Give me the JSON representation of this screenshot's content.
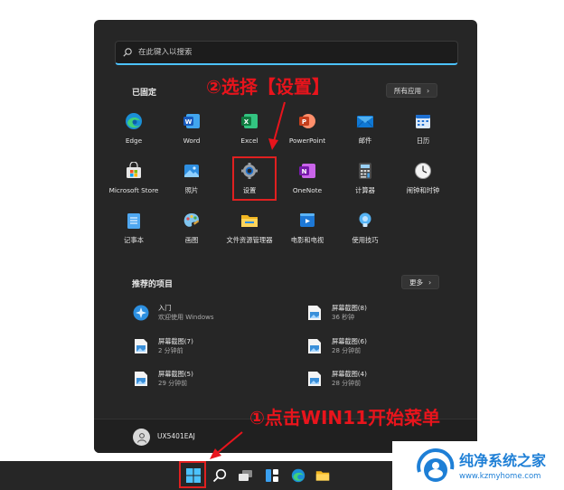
{
  "search": {
    "placeholder": "在此键入以搜索"
  },
  "pinned": {
    "title": "已固定",
    "all_apps_label": "所有应用",
    "apps": [
      {
        "label": "Edge",
        "icon": "edge-icon"
      },
      {
        "label": "Word",
        "icon": "word-icon"
      },
      {
        "label": "Excel",
        "icon": "excel-icon"
      },
      {
        "label": "PowerPoint",
        "icon": "powerpoint-icon"
      },
      {
        "label": "邮件",
        "icon": "mail-icon"
      },
      {
        "label": "日历",
        "icon": "calendar-icon"
      },
      {
        "label": "Microsoft Store",
        "icon": "store-icon"
      },
      {
        "label": "照片",
        "icon": "photos-icon"
      },
      {
        "label": "设置",
        "icon": "settings-gear-icon"
      },
      {
        "label": "OneNote",
        "icon": "onenote-icon"
      },
      {
        "label": "计算器",
        "icon": "calculator-icon"
      },
      {
        "label": "闹钟和时钟",
        "icon": "clock-icon"
      },
      {
        "label": "记事本",
        "icon": "notepad-icon"
      },
      {
        "label": "画图",
        "icon": "paint-icon"
      },
      {
        "label": "文件资源管理器",
        "icon": "folder-icon"
      },
      {
        "label": "电影和电视",
        "icon": "movies-icon"
      },
      {
        "label": "使用技巧",
        "icon": "tips-icon"
      }
    ]
  },
  "recommended": {
    "title": "推荐的项目",
    "more_label": "更多",
    "items": [
      {
        "name": "入门",
        "sub": "欢迎使用 Windows",
        "icon": "get-started-icon"
      },
      {
        "name": "屏幕截图(8)",
        "sub": "36 秒钟",
        "icon": "image-file-icon"
      },
      {
        "name": "屏幕截图(7)",
        "sub": "2 分钟前",
        "icon": "image-file-icon"
      },
      {
        "name": "屏幕截图(6)",
        "sub": "28 分钟前",
        "icon": "image-file-icon"
      },
      {
        "name": "屏幕截图(5)",
        "sub": "29 分钟前",
        "icon": "image-file-icon"
      },
      {
        "name": "屏幕截图(4)",
        "sub": "28 分钟前",
        "icon": "image-file-icon"
      }
    ]
  },
  "user": {
    "name": "UX5401EAJ"
  },
  "annotations": {
    "step1": "①点击WIN11开始菜单",
    "step2": "②选择【设置】"
  },
  "watermark": {
    "name": "纯净系统之家",
    "url": "www.kzmyhome.com"
  },
  "colors": {
    "accent": "#4cc2ff",
    "highlight": "#e02020",
    "annotation": "#e8141c",
    "menu_bg": "#262626"
  }
}
